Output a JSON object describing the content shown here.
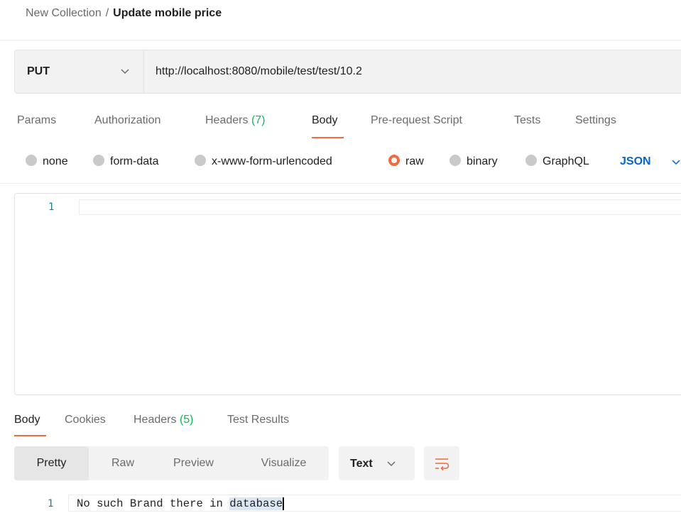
{
  "breadcrumb": {
    "parent": "New Collection",
    "separator": "/",
    "current": "Update mobile price"
  },
  "request": {
    "method": "PUT",
    "url": "http://localhost:8080/mobile/test/test/10.2",
    "tabs": [
      {
        "label": "Params"
      },
      {
        "label": "Authorization"
      },
      {
        "label": "Headers",
        "count": "(7)"
      },
      {
        "label": "Body"
      },
      {
        "label": "Pre-request Script"
      },
      {
        "label": "Tests"
      },
      {
        "label": "Settings"
      }
    ],
    "active_tab": "Body",
    "body_types": [
      "none",
      "form-data",
      "x-www-form-urlencoded",
      "raw",
      "binary",
      "GraphQL"
    ],
    "selected_body_type": "raw",
    "raw_format": "JSON",
    "editor": {
      "line_numbers": [
        "1"
      ]
    }
  },
  "response": {
    "tabs": [
      {
        "label": "Body"
      },
      {
        "label": "Cookies"
      },
      {
        "label": "Headers",
        "count": "(5)"
      },
      {
        "label": "Test Results"
      }
    ],
    "active_tab": "Body",
    "view_modes": [
      "Pretty",
      "Raw",
      "Preview",
      "Visualize"
    ],
    "active_view_mode": "Pretty",
    "format": "Text",
    "lines": [
      {
        "num": "1",
        "before": "No such Brand there in ",
        "highlight": "database"
      }
    ]
  },
  "colors": {
    "accent": "#f26b3a",
    "link_blue": "#0265d2",
    "count_green": "#0cbb52"
  }
}
